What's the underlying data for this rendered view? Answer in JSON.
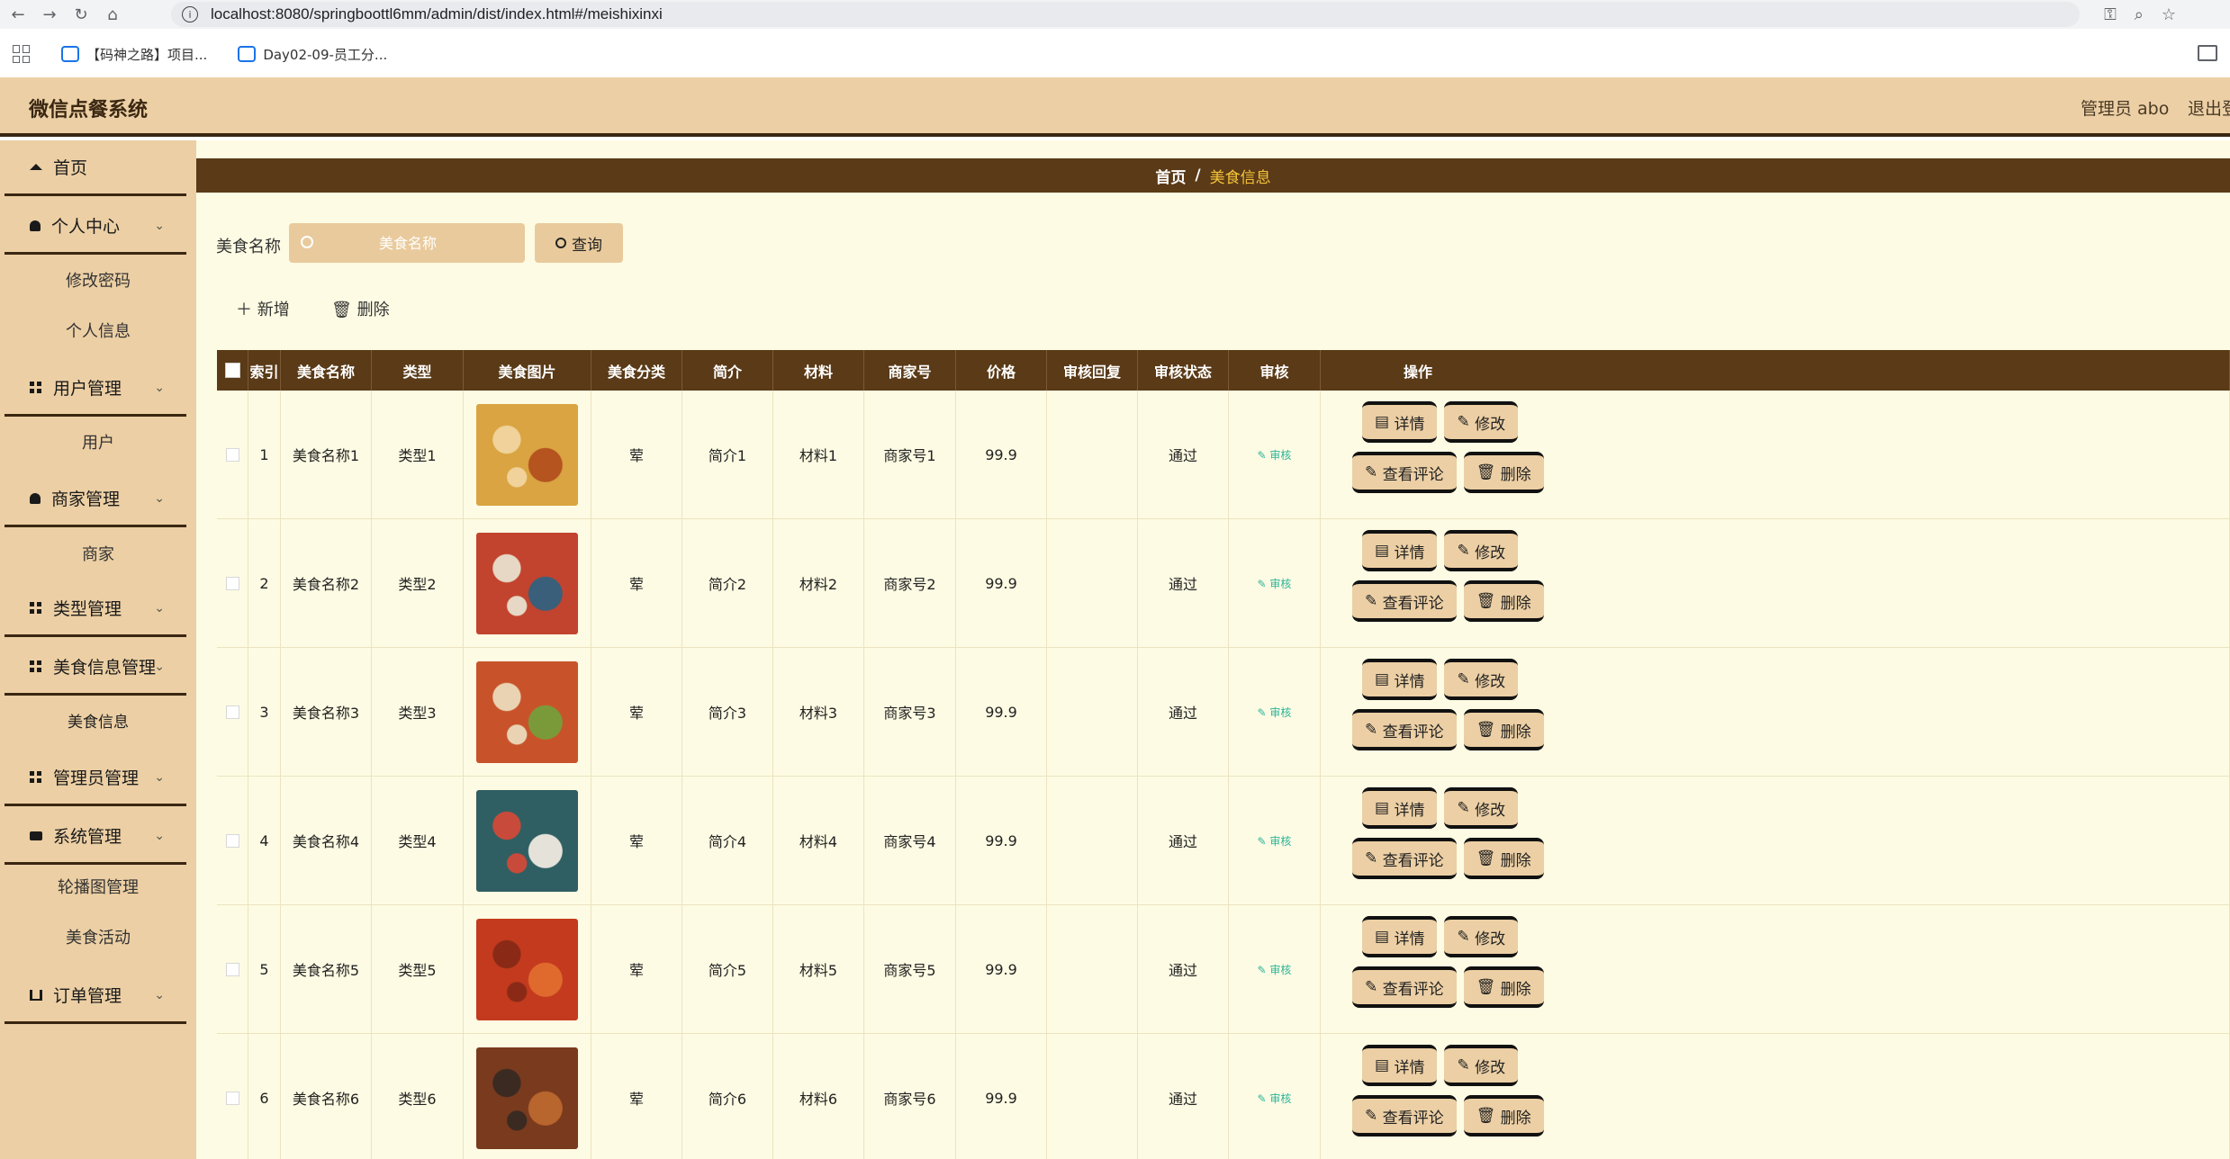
{
  "browser": {
    "url": "localhost:8080/springboottl6mm/admin/dist/index.html#/meishixinxi",
    "bookmarks": [
      "【码神之路】项目...",
      "Day02-09-员工分..."
    ]
  },
  "header": {
    "title": "微信点餐系统",
    "user": "管理员 abo",
    "logout": "退出登"
  },
  "sidebar": {
    "home": "首页",
    "personal": "个人中心",
    "change_password": "修改密码",
    "profile": "个人信息",
    "user_mgmt": "用户管理",
    "users": "用户",
    "merchant_mgmt": "商家管理",
    "merchants": "商家",
    "type_mgmt": "类型管理",
    "food_mgmt": "美食信息管理",
    "food_info": "美食信息",
    "admin_mgmt": "管理员管理",
    "system_mgmt": "系统管理",
    "carousel": "轮播图管理",
    "activities": "美食活动",
    "order_mgmt": "订单管理"
  },
  "breadcrumb": {
    "home": "首页",
    "sep": "/",
    "current": "美食信息"
  },
  "search": {
    "label": "美食名称",
    "placeholder": "美食名称",
    "button": "查询"
  },
  "toolbar": {
    "add": "新增",
    "delete": "删除"
  },
  "table": {
    "headers": [
      "索引",
      "美食名称",
      "类型",
      "美食图片",
      "美食分类",
      "简介",
      "材料",
      "商家号",
      "价格",
      "审核回复",
      "审核状态",
      "审核",
      "操作"
    ],
    "rows": [
      {
        "idx": "1",
        "name": "美食名称1",
        "type": "类型1",
        "category": "荤",
        "intro": "简介1",
        "material": "材料1",
        "merchant": "商家号1",
        "price": "99.9",
        "reply": "",
        "status": "通过",
        "audit": "审核"
      },
      {
        "idx": "2",
        "name": "美食名称2",
        "type": "类型2",
        "category": "荤",
        "intro": "简介2",
        "material": "材料2",
        "merchant": "商家号2",
        "price": "99.9",
        "reply": "",
        "status": "通过",
        "audit": "审核"
      },
      {
        "idx": "3",
        "name": "美食名称3",
        "type": "类型3",
        "category": "荤",
        "intro": "简介3",
        "material": "材料3",
        "merchant": "商家号3",
        "price": "99.9",
        "reply": "",
        "status": "通过",
        "audit": "审核"
      },
      {
        "idx": "4",
        "name": "美食名称4",
        "type": "类型4",
        "category": "荤",
        "intro": "简介4",
        "material": "材料4",
        "merchant": "商家号4",
        "price": "99.9",
        "reply": "",
        "status": "通过",
        "audit": "审核"
      },
      {
        "idx": "5",
        "name": "美食名称5",
        "type": "类型5",
        "category": "荤",
        "intro": "简介5",
        "material": "材料5",
        "merchant": "商家号5",
        "price": "99.9",
        "reply": "",
        "status": "通过",
        "audit": "审核"
      },
      {
        "idx": "6",
        "name": "美食名称6",
        "type": "类型6",
        "category": "荤",
        "intro": "简介6",
        "material": "材料6",
        "merchant": "商家号6",
        "price": "99.9",
        "reply": "",
        "status": "通过",
        "audit": "审核"
      }
    ],
    "actions": {
      "detail": "详情",
      "edit": "修改",
      "comments": "查看评论",
      "delete": "删除"
    }
  },
  "colors": {
    "header_bg": "#eccfa4",
    "dark_brown": "#5a3a17",
    "content_bg": "#fdfbe3",
    "breadcrumb_current": "#f5c43a",
    "audit_link": "#2bb49a"
  }
}
